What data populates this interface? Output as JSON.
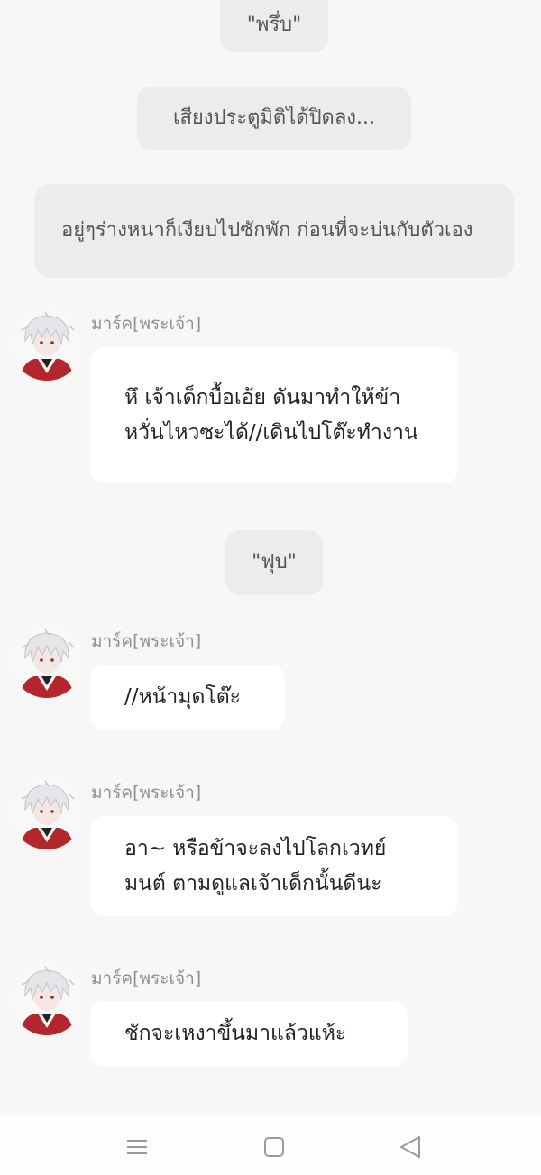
{
  "narrations": [
    {
      "text": "\"พรึ่บ\""
    },
    {
      "text": "เสียงประตูมิติได้ปิดลง..."
    },
    {
      "text": "อยู่ๆร่างหนาก็เงียบไปซักพัก ก่อนที่จะบ่นกับตัวเอง"
    },
    {
      "text": "\"ฟุบ\""
    }
  ],
  "messages": [
    {
      "sender": "มาร์ค[พระเจ้า]",
      "text": "หึ เจ้าเด็กบื้อเอ้ย ดันมาทำให้ข้าหวั่นไหวซะได้//เดินไปโต๊ะทำงาน"
    },
    {
      "sender": "มาร์ค[พระเจ้า]",
      "text": "//หน้ามุดโต๊ะ"
    },
    {
      "sender": "มาร์ค[พระเจ้า]",
      "text": "อา~ หรือข้าจะลงไปโลกเวทย์มนต์ ตามดูแลเจ้าเด็กนั้นดีนะ"
    },
    {
      "sender": "มาร์ค[พระเจ้า]",
      "text": "ชักจะเหงาขึ้นมาแล้วแห้ะ"
    }
  ],
  "avatar": {
    "hair_color": "#e6e6ea",
    "jacket_color": "#b3262c",
    "icon": "avatar-icon"
  },
  "navbar": {
    "icons": [
      "menu-icon",
      "home-square-icon",
      "back-triangle-icon"
    ]
  }
}
